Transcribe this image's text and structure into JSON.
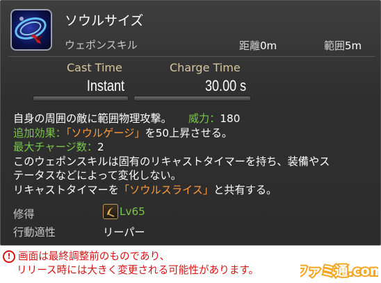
{
  "action": {
    "name": "ソウルサイズ",
    "type": "ウェポンスキル",
    "icon": "soul-scythe-icon",
    "range": {
      "label": "距離",
      "value": "0m"
    },
    "radius": {
      "label": "範囲",
      "value": "5m"
    }
  },
  "timing": {
    "cast_label": "Cast Time",
    "cast_value": "Instant",
    "charge_label": "Charge Time",
    "charge_value": "30.00 s"
  },
  "description": {
    "line1_text": "自身の周囲の敵に範囲物理攻撃。",
    "potency_label": "威力：",
    "potency_value": "180",
    "additional_label": "追加効果：",
    "additional_highlight": "「ソウルゲージ」",
    "additional_rest": "を50上昇させる。",
    "charges_label": "最大チャージ数：",
    "charges_value": "2",
    "line4": "このウェポンスキルは固有のリキャストタイマーを持ち、装備やス",
    "line5": "テータスなどによって変化しない。",
    "line6_pre": "リキャストタイマーを",
    "line6_highlight": "「ソウルスライス」",
    "line6_post": "と共有する。"
  },
  "acquired": {
    "label": "修得",
    "level": "Lv65",
    "icon": "reaper-job-icon"
  },
  "affinity": {
    "label": "行動適性",
    "value": "リーパー"
  },
  "notice": {
    "icon": "exclamation-icon",
    "line1": "画面は最終調整前のものであり、",
    "line2": "リリース時には大きく変更される可能性があります。"
  },
  "brand": {
    "text": "ファミ通.com"
  },
  "colors": {
    "panel": "#2f2f2f",
    "label_gold": "#d8c79b",
    "green": "#79c74a",
    "orange": "#ff9a3a",
    "warning_red": "#d41414",
    "brand_orange": "#f5a623"
  }
}
